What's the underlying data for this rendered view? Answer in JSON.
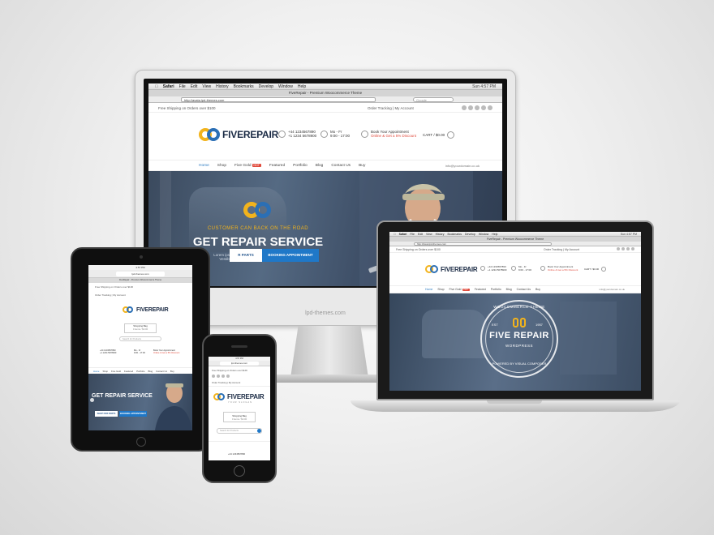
{
  "monitor": {
    "mac_menu": [
      "Safari",
      "File",
      "Edit",
      "View",
      "History",
      "Bookmarks",
      "Develop",
      "Window",
      "Help"
    ],
    "mac_clock": "Sun 4:57 PM",
    "tab_title": "FiveRepair - Premium Woocommerce Theme",
    "url": "http://avata.lpd-themes.com",
    "search_placeholder": "Google",
    "free_shipping": "Free Shipping on Orders over $100",
    "order_tracking": "Order Tracking",
    "my_account": "My Account",
    "logo": "FIVEREPAIR",
    "phone_lines": [
      "+44 1234567890",
      "+1 1234 5678900"
    ],
    "hours_label": "Mo - Fr",
    "hours": "9:00 - 17:00",
    "appointment_label": "Book Your Appointment",
    "appointment_online": "Online & Get a 5% Discount",
    "cart": "CART / $0.00",
    "nav": [
      "Home",
      "Shop",
      "Five Gold",
      "Featured",
      "Portfolio",
      "Blog",
      "Contact Us",
      "Buy"
    ],
    "nav_hot": "HOT",
    "email": "info@yourdomain.co.uk",
    "hero_tagline": "CUSTOMER CAN BACK ON THE ROAD",
    "hero_title": "GET REPAIR SERVICE",
    "hero_body": "Lorem ipsum dolor sit amet, consectetur adipiscing elit. Vestibulum pharetra nisi tristique dictum cursus.",
    "btn_parts": "R PARTS",
    "btn_booking": "BOOKING APPOINTMENT",
    "chin_label": "lpd-themes.com"
  },
  "laptop": {
    "mac_menu": [
      "Safari",
      "File",
      "Edit",
      "View",
      "History",
      "Bookmarks",
      "Develop",
      "Window",
      "Help"
    ],
    "mac_clock": "Sun 4:57 PM",
    "tab_title": "FiveRepair - Premium Woocommerce Theme",
    "url": "http://www.lpd-themes.com",
    "free_shipping": "Free Shipping on Orders over $100",
    "order_tracking": "Order Tracking",
    "my_account": "My Account",
    "logo": "FIVEREPAIR",
    "phone_lines": [
      "+44 1234567890",
      "+1 1234 5678900"
    ],
    "hours_label": "Mo - Fr",
    "hours": "9:00 - 17:00",
    "appointment_label": "Book Your Appointment",
    "appointment_online": "Online & Get a 5% Discount",
    "cart": "CART / $0.00",
    "nav": [
      "Home",
      "Shop",
      "Five Gold",
      "Featured",
      "Portfolio",
      "Blog",
      "Contact Us",
      "Buy"
    ],
    "nav_hot": "HOT",
    "email": "info@yourdomain.co.uk",
    "badge_top": "WOOCOMMERCE THEME",
    "badge_est": "EST",
    "badge_year": "1957",
    "badge_title": "FIVE REPAIR",
    "badge_wp": "WORDPRESS",
    "badge_bottom": "POWERED BY VISUAL COMPOSER"
  },
  "tablet": {
    "clock": "4:57 PM",
    "url": "lpd-themes.com",
    "tab_title": "FiveRepair - Premium Woocommerce Theme",
    "free_shipping": "Free Shipping on Orders over $100",
    "order_tracking": "Order Tracking",
    "my_account": "My Account",
    "logo": "FIVEREPAIR",
    "cart_label": "Shopping Bag",
    "cart_items": "0 items / $0.00",
    "search_placeholder": "Search for Products",
    "phone": "+44 1234567890",
    "phone2": "+1 1234 5678900",
    "hours_label": "Mo - Fr",
    "hours": "9:00 - 17:00",
    "appointment_label": "Book Your Appointment",
    "appointment_online": "Online & Get a 5% Discount",
    "nav": [
      "Home",
      "Shop",
      "Five Gold",
      "Featured",
      "Portfolio",
      "Blog",
      "Contact Us",
      "Buy"
    ],
    "hero_title": "GET REPAIR SERVICE",
    "btn_parts": "SHOP FOR PARTS",
    "btn_booking": "BOOKING APPOINTMENT"
  },
  "phone": {
    "clock": "4:57 PM",
    "url": "lpd-themes.com",
    "free_shipping": "Free Shipping on Orders over $100",
    "order_tracking": "Order Tracking",
    "my_account": "My Account",
    "logo": "FIVEREPAIR",
    "logo_sub": "YOUR SLOGAN",
    "cart_label": "Shopping Bag",
    "cart_items": "0 items / $0.00",
    "search_placeholder": "Search for Products",
    "phone": "+44 1234567890"
  },
  "colors": {
    "brand_blue": "#1f78c8",
    "brand_yellow": "#f2b31c",
    "hot_red": "#e04a3c",
    "hero_dark": "#3b4a5e"
  }
}
